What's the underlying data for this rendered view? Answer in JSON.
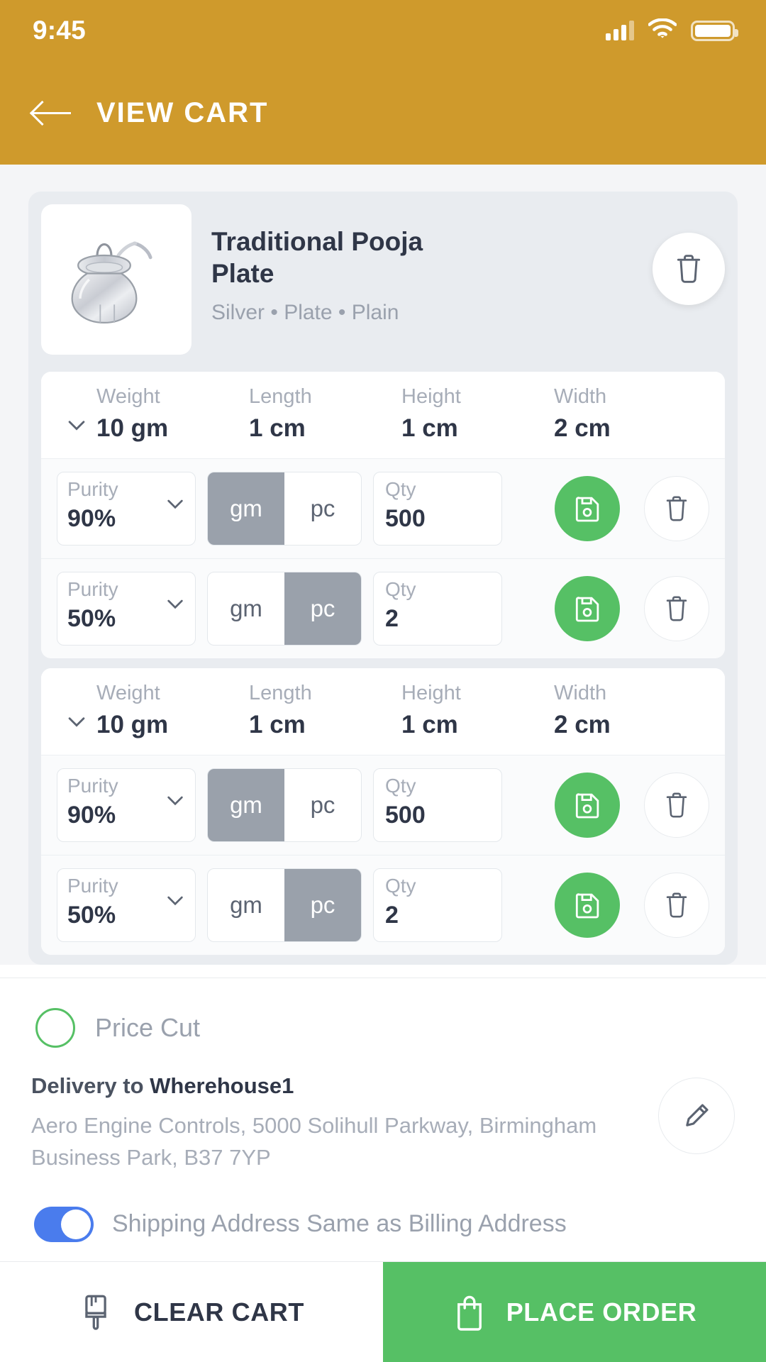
{
  "status_bar": {
    "time": "9:45",
    "signal_icon": "signal-bars-icon",
    "wifi_icon": "wifi-icon",
    "battery_icon": "battery-icon"
  },
  "header": {
    "title": "VIEW CART",
    "back_icon": "back-arrow-icon",
    "background_color": "#cf9a2c"
  },
  "product": {
    "name": "Traditional Pooja Plate",
    "meta": "Silver • Plate • Plain",
    "image_icon": "silver-pooja-pot-image",
    "delete_icon": "trash-icon"
  },
  "dimension_labels": {
    "weight": "Weight",
    "length": "Length",
    "height": "Height",
    "width": "Width"
  },
  "groups": [
    {
      "weight": "10 gm",
      "length": "1 cm",
      "height": "1 cm",
      "width": "2 cm",
      "variants": [
        {
          "purity_label": "Purity",
          "purity_value": "90%",
          "unit_gm": "gm",
          "unit_pc": "pc",
          "unit_selected": "gm",
          "qty_label": "Qty",
          "qty_value": "500"
        },
        {
          "purity_label": "Purity",
          "purity_value": "50%",
          "unit_gm": "gm",
          "unit_pc": "pc",
          "unit_selected": "pc",
          "qty_label": "Qty",
          "qty_value": "2"
        }
      ]
    },
    {
      "weight": "10 gm",
      "length": "1 cm",
      "height": "1 cm",
      "width": "2 cm",
      "variants": [
        {
          "purity_label": "Purity",
          "purity_value": "90%",
          "unit_gm": "gm",
          "unit_pc": "pc",
          "unit_selected": "gm",
          "qty_label": "Qty",
          "qty_value": "500"
        },
        {
          "purity_label": "Purity",
          "purity_value": "50%",
          "unit_gm": "gm",
          "unit_pc": "pc",
          "unit_selected": "pc",
          "qty_label": "Qty",
          "qty_value": "2"
        }
      ]
    }
  ],
  "price_cut": {
    "label": "Price Cut",
    "checked": false,
    "accent_color": "#56c065"
  },
  "delivery": {
    "title_prefix": "Delivery to ",
    "warehouse": "Wherehouse1",
    "address": "Aero Engine Controls, 5000 Solihull Parkway, Birmingham Business Park, B37 7YP",
    "edit_icon": "pencil-icon"
  },
  "shipping_toggle": {
    "label": "Shipping Address Same as Billing Address",
    "on": true,
    "on_color": "#4a7ced"
  },
  "bottom_bar": {
    "clear_label": "CLEAR CART",
    "clear_icon": "brush-icon",
    "order_label": "PLACE ORDER",
    "order_icon": "shopping-bag-icon",
    "order_color": "#56c065"
  },
  "icons": {
    "save": "save-floppy-icon",
    "trash": "trash-icon",
    "chevron_down": "chevron-down-icon"
  }
}
